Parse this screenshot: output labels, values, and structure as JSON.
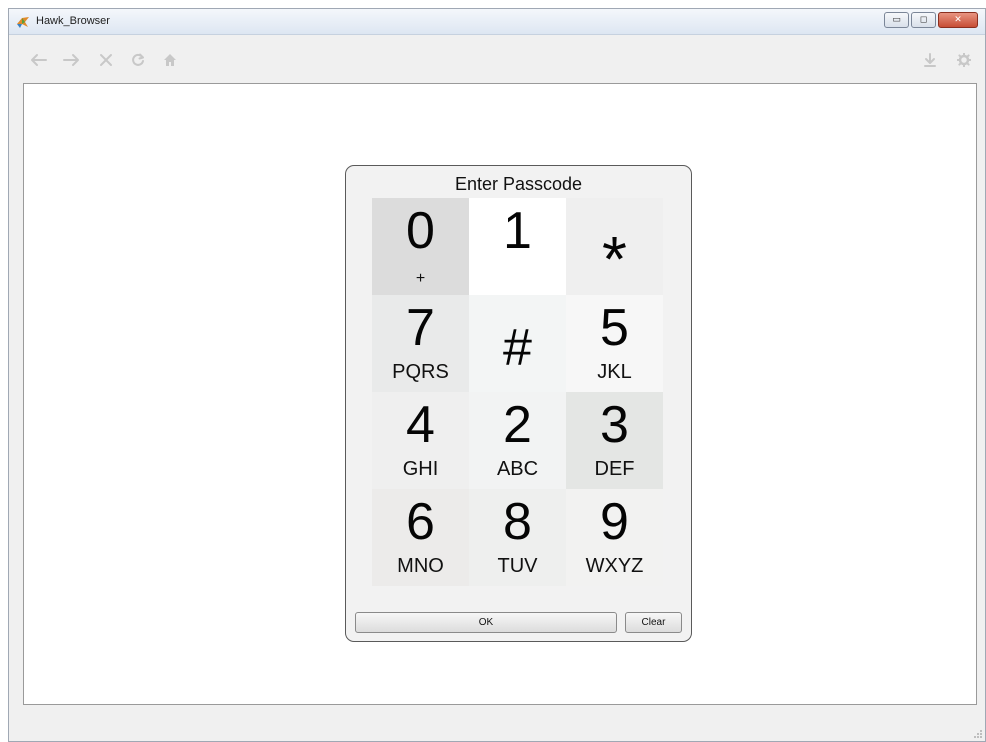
{
  "window": {
    "title": "Hawk_Browser",
    "buttons": [
      {
        "name": "minimize",
        "glyph": "▭"
      },
      {
        "name": "maximize",
        "glyph": "◻"
      },
      {
        "name": "close",
        "glyph": "✕"
      }
    ]
  },
  "toolbar": {
    "nav_icons": [
      "back-arrow-icon",
      "forward-arrow-icon",
      "stop-icon",
      "reload-icon",
      "home-icon"
    ],
    "right_icons": [
      "download-icon",
      "settings-gear-icon"
    ],
    "icon_color": "#c8c8c8"
  },
  "dialog": {
    "title": "Enter Passcode",
    "keys": [
      {
        "digit": "0",
        "sub": "+",
        "bg": "#dcdcdc"
      },
      {
        "digit": "1",
        "sub": "",
        "bg": "#ffffff"
      },
      {
        "symbol": "*",
        "bg": "#efefef"
      },
      {
        "digit": "7",
        "sub": "PQRS",
        "bg": "#e9eaea"
      },
      {
        "symbol": "#",
        "bg": "#f3f5f5"
      },
      {
        "digit": "5",
        "sub": "JKL",
        "bg": "#f7f7f7"
      },
      {
        "digit": "4",
        "sub": "GHI",
        "bg": "#efefef"
      },
      {
        "digit": "2",
        "sub": "ABC",
        "bg": "#f2f3f3"
      },
      {
        "digit": "3",
        "sub": "DEF",
        "bg": "#e4e6e4"
      },
      {
        "digit": "6",
        "sub": "MNO",
        "bg": "#ecebea"
      },
      {
        "digit": "8",
        "sub": "TUV",
        "bg": "#eeefee"
      },
      {
        "digit": "9",
        "sub": "WXYZ",
        "bg": "#f2f2f1"
      }
    ],
    "ok_label": "OK",
    "clear_label": "Clear"
  }
}
